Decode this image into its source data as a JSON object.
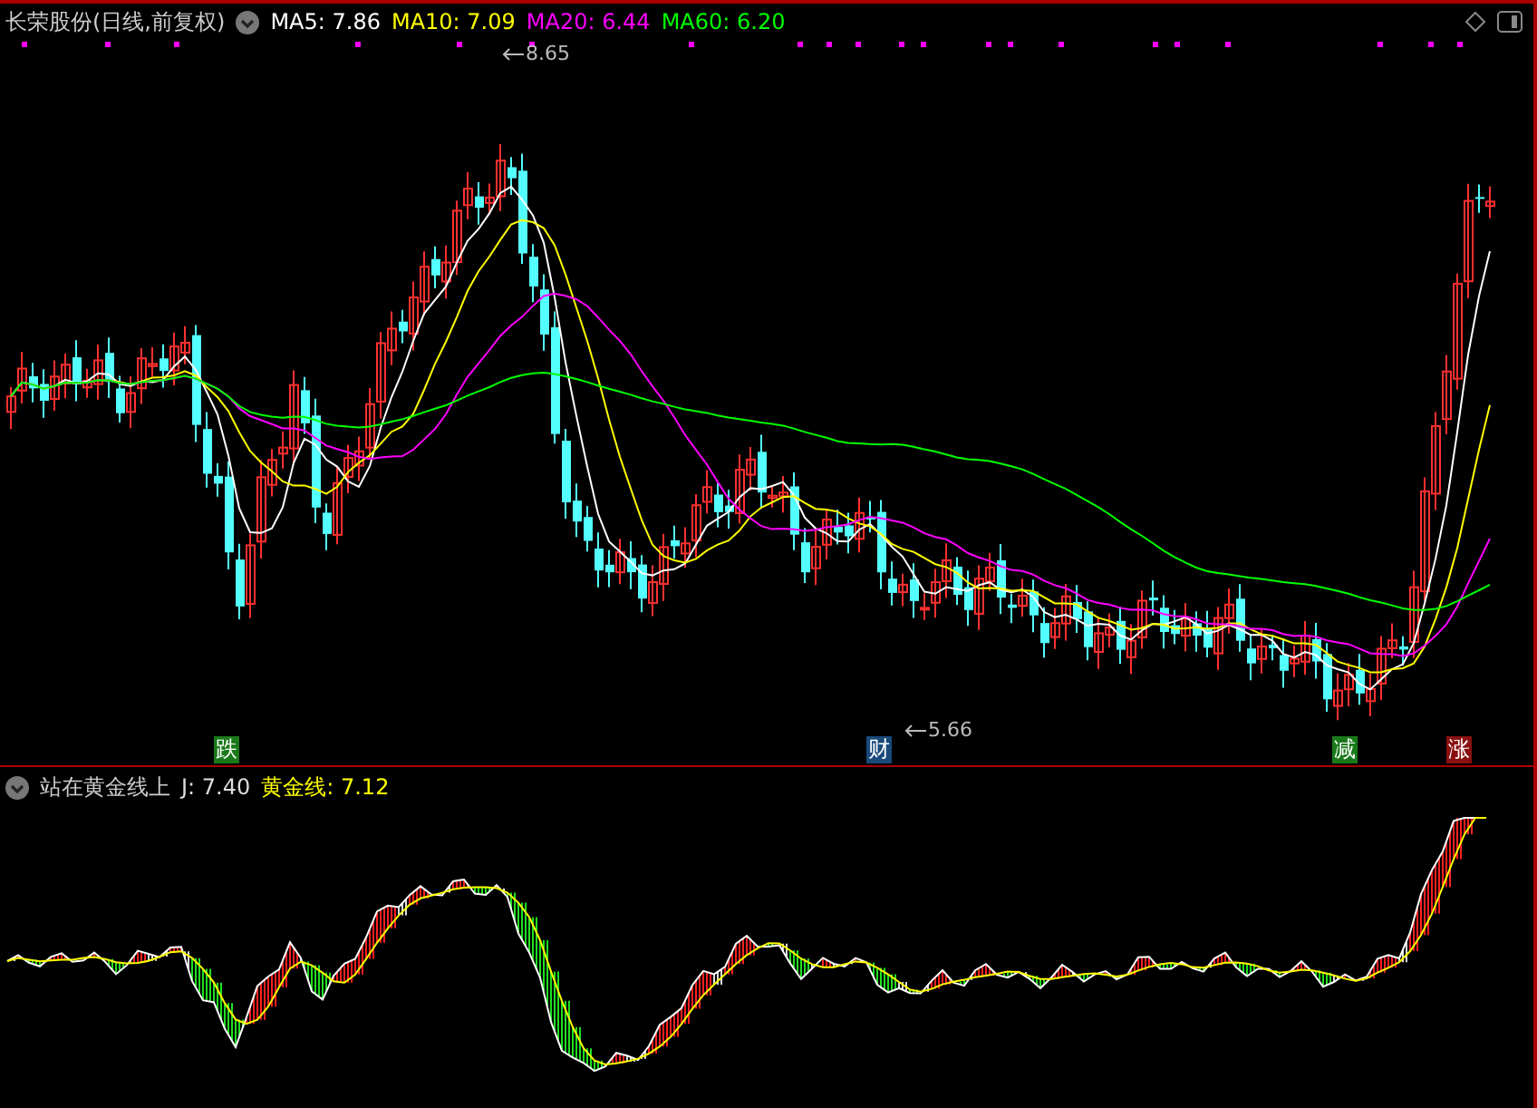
{
  "header": {
    "title": "长荣股份(日线,前复权)",
    "indicators": [
      {
        "label": "MA5: 7.86",
        "color": "#ffffff"
      },
      {
        "label": "MA10: 7.09",
        "color": "#ffff00"
      },
      {
        "label": "MA20: 6.44",
        "color": "#ff00ff"
      },
      {
        "label": "MA60: 6.20",
        "color": "#00ff00"
      }
    ]
  },
  "price_labels": [
    {
      "text": "8.65"
    },
    {
      "text": "5.66"
    }
  ],
  "markers": [
    {
      "text": "跌",
      "color": "#1a7a1a"
    },
    {
      "text": "财",
      "color": "#1a4a7a"
    },
    {
      "text": "减",
      "color": "#1a7a1a"
    },
    {
      "text": "涨",
      "color": "#8a1010"
    }
  ],
  "lower_panel": {
    "title": "站在黄金线上",
    "readings": [
      {
        "label": "J: 7.40",
        "color": "#dddddd"
      },
      {
        "label": "黄金线: 7.12",
        "color": "#ffff00"
      }
    ]
  }
}
